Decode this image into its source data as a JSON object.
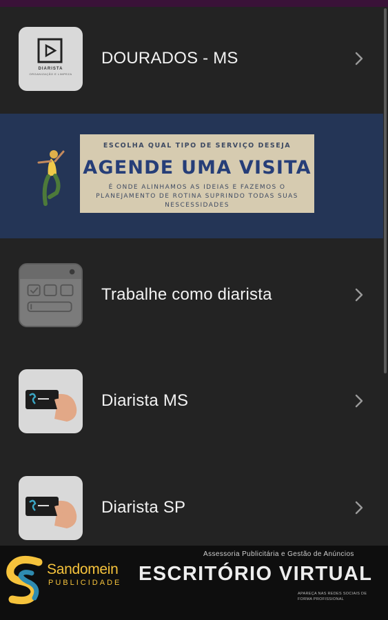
{
  "list": {
    "items": [
      {
        "label": "DOURADOS - MS",
        "thumb_text": "DIARISTA",
        "thumb_subtext": "ORGANIZAÇÃO E LIMPEZA"
      },
      {
        "label": "Trabalhe como diarista"
      },
      {
        "label": "Diarista MS"
      },
      {
        "label": "Diarista SP"
      }
    ]
  },
  "banner": {
    "top_text": "ESCOLHA QUAL TIPO DE SERVIÇO DESEJA",
    "title": "AGENDE UMA VISITA",
    "subtitle": "É ONDE ALINHAMOS AS IDEIAS E FAZEMOS O PLANEJAMENTO DE ROTINA SUPRINDO TODAS SUAS NESCESSIDADES"
  },
  "footer": {
    "brand": "Sandomein",
    "brand_sub": "PUBLICIDADE",
    "tagline": "Assessoria Publicitária e Gestão de Anúncios",
    "title": "ESCRITÓRIO VIRTUAL",
    "small_text": "APAREÇA NAS REDES SOCIAIS DE FORMA PROFISSIONAL"
  },
  "colors": {
    "background": "#232323",
    "banner_bg": "#243556",
    "brand_yellow": "#f6c33c",
    "top_strip": "#3a1238"
  },
  "icons": [
    "play-logo-icon",
    "form-window-icon",
    "card-hand-icon",
    "chevron-right-icon"
  ]
}
